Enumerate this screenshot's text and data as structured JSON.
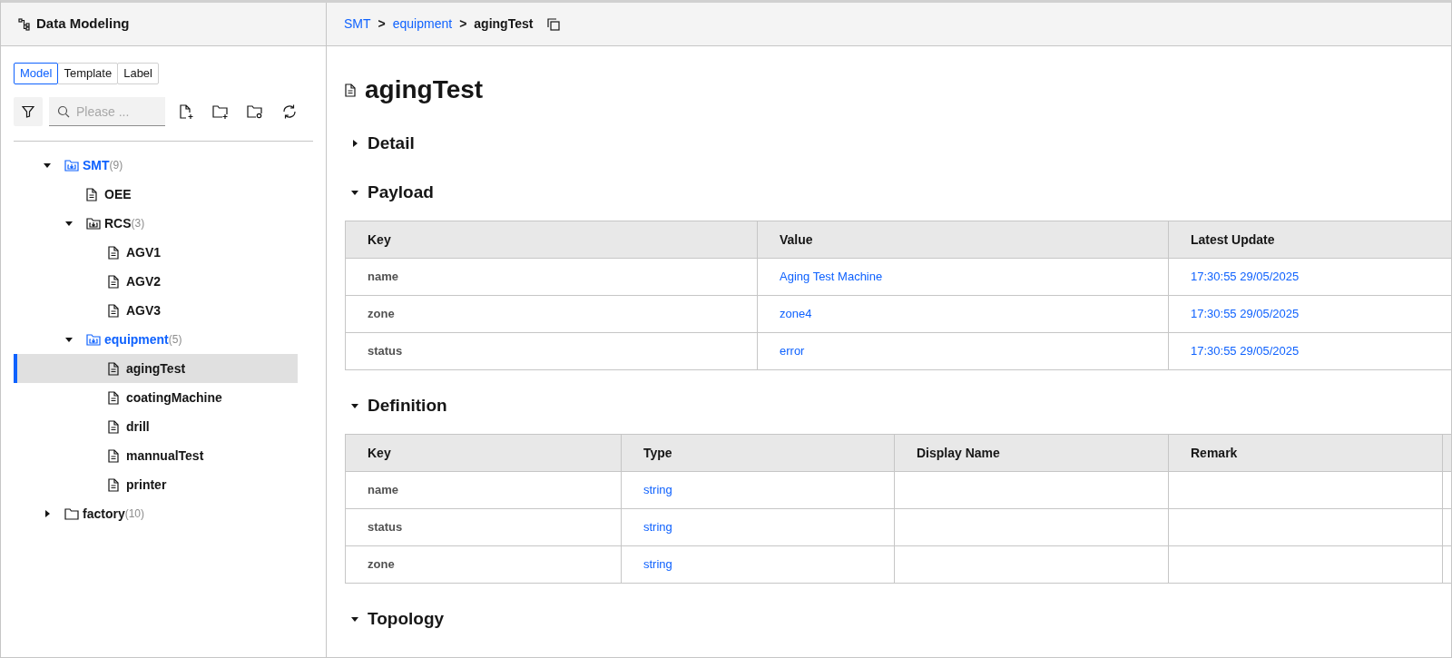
{
  "sidebar": {
    "title": "Data Modeling",
    "tabs": [
      {
        "label": "Model",
        "selected": true
      },
      {
        "label": "Template",
        "selected": false
      },
      {
        "label": "Label",
        "selected": false
      }
    ],
    "search": {
      "placeholder": "Please ..."
    },
    "tree": [
      {
        "kind": "group",
        "label": "SMT",
        "count": "(9)",
        "expanded": true,
        "in_path": true,
        "selected": false,
        "children": [
          {
            "kind": "file",
            "label": "OEE",
            "selected": false
          },
          {
            "kind": "group",
            "label": "RCS",
            "count": "(3)",
            "expanded": true,
            "in_path": false,
            "selected": false,
            "children": [
              {
                "kind": "file",
                "label": "AGV1",
                "selected": false
              },
              {
                "kind": "file",
                "label": "AGV2",
                "selected": false
              },
              {
                "kind": "file",
                "label": "AGV3",
                "selected": false
              }
            ]
          },
          {
            "kind": "group",
            "label": "equipment",
            "count": "(5)",
            "expanded": true,
            "in_path": true,
            "selected": false,
            "children": [
              {
                "kind": "file",
                "label": "agingTest",
                "selected": true
              },
              {
                "kind": "file",
                "label": "coatingMachine",
                "selected": false
              },
              {
                "kind": "file",
                "label": "drill",
                "selected": false
              },
              {
                "kind": "file",
                "label": "mannualTest",
                "selected": false
              },
              {
                "kind": "file",
                "label": "printer",
                "selected": false
              }
            ]
          }
        ]
      },
      {
        "kind": "folder",
        "label": "factory",
        "count": "(10)",
        "expanded": false,
        "in_path": false,
        "selected": false
      }
    ]
  },
  "breadcrumb": [
    {
      "label": "SMT",
      "link": true
    },
    {
      "label": ">",
      "link": false
    },
    {
      "label": "equipment",
      "link": true
    },
    {
      "label": ">",
      "link": false
    },
    {
      "label": "agingTest",
      "link": false
    }
  ],
  "title": "agingTest",
  "sections": [
    {
      "title": "Detail",
      "expanded": false
    },
    {
      "title": "Payload",
      "expanded": true,
      "table": {
        "columns": [
          "Key",
          "Value",
          "Latest Update"
        ],
        "rows": [
          [
            "name",
            "Aging Test Machine",
            "17:30:55 29/05/2025"
          ],
          [
            "zone",
            "zone4",
            "17:30:55 29/05/2025"
          ],
          [
            "status",
            "error",
            "17:30:55 29/05/2025"
          ]
        ]
      }
    },
    {
      "title": "Definition",
      "expanded": true,
      "table": {
        "columns": [
          "Key",
          "Type",
          "Display Name",
          "Remark"
        ],
        "rows": [
          [
            "name",
            "string"
          ],
          [
            "status",
            "string"
          ],
          [
            "zone",
            "string"
          ]
        ]
      }
    },
    {
      "title": "Topology",
      "expanded": true
    }
  ]
}
